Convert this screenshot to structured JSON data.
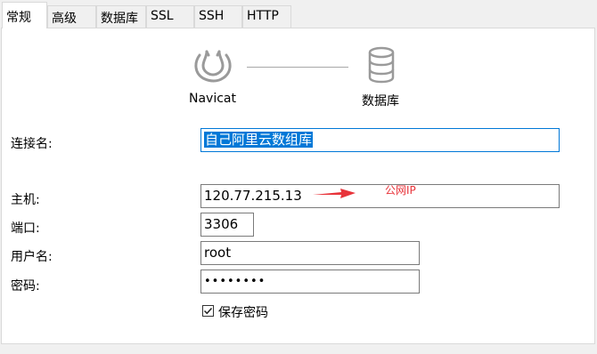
{
  "tabs": [
    "常规",
    "高级",
    "数据库",
    "SSL",
    "SSH",
    "HTTP"
  ],
  "diagram": {
    "left_label": "Navicat",
    "right_label": "数据库",
    "left_icon": "navicat-logo-icon",
    "right_icon": "database-icon"
  },
  "form": {
    "connection_name_label": "连接名:",
    "connection_name_value": "自己阿里云数组库",
    "host_label": "主机:",
    "host_value": "120.77.215.13",
    "port_label": "端口:",
    "port_value": "3306",
    "user_label": "用户名:",
    "user_value": "root",
    "password_label": "密码:",
    "password_value": "••••••••",
    "save_password_label": "保存密码",
    "save_password_checked": true
  },
  "annotation": {
    "text": "公网IP",
    "color": "#e8333a"
  }
}
